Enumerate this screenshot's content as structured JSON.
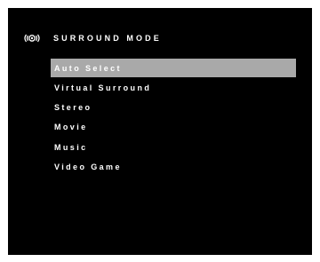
{
  "header": {
    "title": "SURROUND MODE",
    "icon": "surround-sound-icon"
  },
  "menu": {
    "selected_index": 0,
    "items": [
      {
        "label": "Auto Select"
      },
      {
        "label": "Virtual Surround"
      },
      {
        "label": "Stereo"
      },
      {
        "label": "Movie"
      },
      {
        "label": "Music"
      },
      {
        "label": "Video Game"
      }
    ]
  },
  "colors": {
    "screen_background": "#000000",
    "text": "#ffffff",
    "highlight": "#a9a9a9"
  }
}
